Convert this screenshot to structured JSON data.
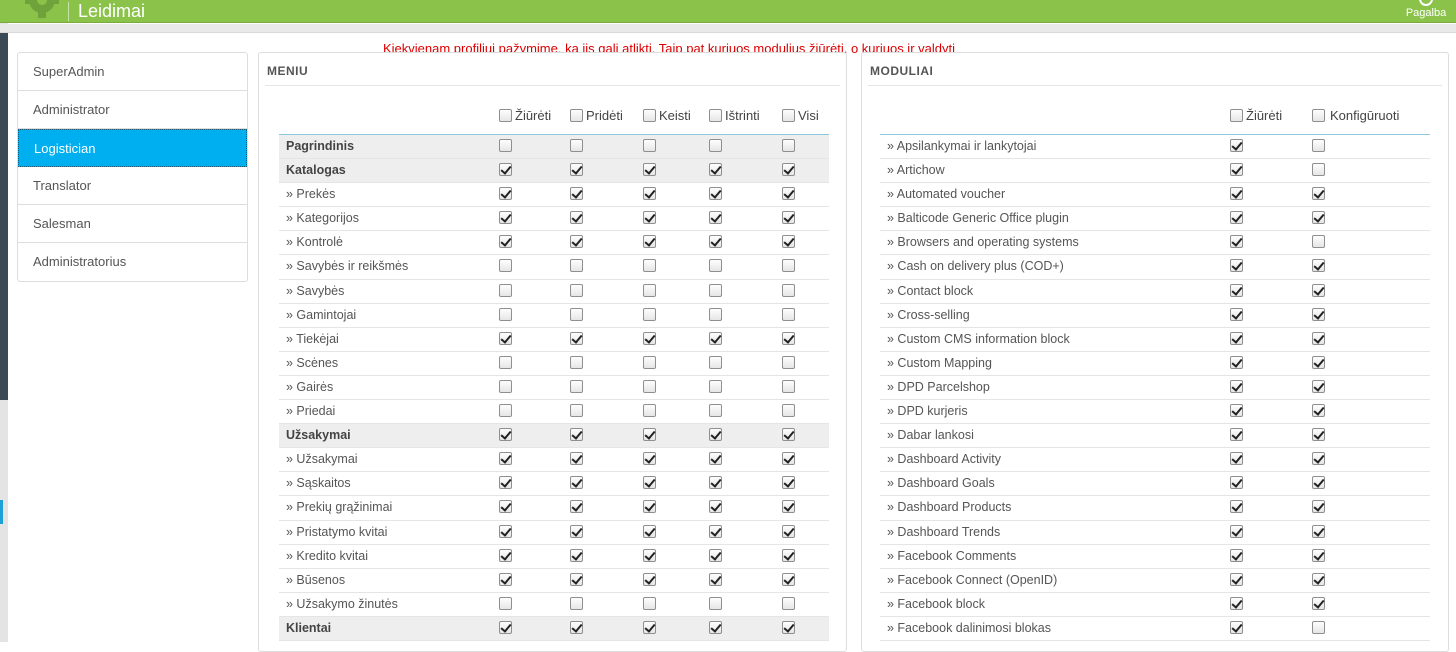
{
  "header": {
    "title": "Leidimai",
    "help_label": "Pagalba",
    "accent": "#8bc34a"
  },
  "notice": "Kiekvienam profiliui pažymime, ką jis gali atlikti. Taip pat kuriuos modulius žiūrėti, o kuriuos ir valdyti",
  "profiles": [
    {
      "label": "SuperAdmin",
      "active": false
    },
    {
      "label": "Administrator",
      "active": false
    },
    {
      "label": "Logistician",
      "active": true
    },
    {
      "label": "Translator",
      "active": false
    },
    {
      "label": "Salesman",
      "active": false
    },
    {
      "label": "Administratorius",
      "active": false
    }
  ],
  "menu": {
    "title": "MENIU",
    "columns": [
      "Žiūrėti",
      "Pridėti",
      "Keisti",
      "Ištrinti",
      "Visi"
    ],
    "rows": [
      {
        "label": "Pagrindinis",
        "group": true,
        "checks": [
          false,
          false,
          false,
          false,
          false
        ]
      },
      {
        "label": "Katalogas",
        "group": true,
        "checks": [
          true,
          true,
          true,
          true,
          true
        ]
      },
      {
        "label": "» Prekės",
        "group": false,
        "checks": [
          true,
          true,
          true,
          true,
          true
        ]
      },
      {
        "label": "» Kategorijos",
        "group": false,
        "checks": [
          true,
          true,
          true,
          true,
          true
        ]
      },
      {
        "label": "» Kontrolė",
        "group": false,
        "checks": [
          true,
          true,
          true,
          true,
          true
        ]
      },
      {
        "label": "» Savybės ir reikšmės",
        "group": false,
        "checks": [
          false,
          false,
          false,
          false,
          false
        ]
      },
      {
        "label": "» Savybės",
        "group": false,
        "checks": [
          false,
          false,
          false,
          false,
          false
        ]
      },
      {
        "label": "» Gamintojai",
        "group": false,
        "checks": [
          false,
          false,
          false,
          false,
          false
        ]
      },
      {
        "label": "» Tiekėjai",
        "group": false,
        "checks": [
          true,
          true,
          true,
          true,
          true
        ]
      },
      {
        "label": "» Scėnes",
        "group": false,
        "checks": [
          false,
          false,
          false,
          false,
          false
        ]
      },
      {
        "label": "» Gairės",
        "group": false,
        "checks": [
          false,
          false,
          false,
          false,
          false
        ]
      },
      {
        "label": "» Priedai",
        "group": false,
        "checks": [
          false,
          false,
          false,
          false,
          false
        ]
      },
      {
        "label": "Užsakymai",
        "group": true,
        "checks": [
          true,
          true,
          true,
          true,
          true
        ]
      },
      {
        "label": "» Užsakymai",
        "group": false,
        "checks": [
          true,
          true,
          true,
          true,
          true
        ]
      },
      {
        "label": "» Sąskaitos",
        "group": false,
        "checks": [
          true,
          true,
          true,
          true,
          true
        ]
      },
      {
        "label": "» Prekių grąžinimai",
        "group": false,
        "checks": [
          true,
          true,
          true,
          true,
          true
        ]
      },
      {
        "label": "» Pristatymo kvitai",
        "group": false,
        "checks": [
          true,
          true,
          true,
          true,
          true
        ]
      },
      {
        "label": "» Kredito kvitai",
        "group": false,
        "checks": [
          true,
          true,
          true,
          true,
          true
        ]
      },
      {
        "label": "» Būsenos",
        "group": false,
        "checks": [
          true,
          true,
          true,
          true,
          true
        ]
      },
      {
        "label": "» Užsakymo žinutės",
        "group": false,
        "checks": [
          false,
          false,
          false,
          false,
          false
        ]
      },
      {
        "label": "Klientai",
        "group": true,
        "checks": [
          true,
          true,
          true,
          true,
          true
        ]
      }
    ]
  },
  "modules": {
    "title": "MODULIAI",
    "columns": [
      "Žiūrėti",
      "Konfigūruoti"
    ],
    "rows": [
      {
        "label": "» Apsilankymai ir lankytojai",
        "checks": [
          true,
          false
        ]
      },
      {
        "label": "» Artichow",
        "checks": [
          true,
          false
        ]
      },
      {
        "label": "» Automated voucher",
        "checks": [
          true,
          true
        ]
      },
      {
        "label": "» Balticode Generic Office plugin",
        "checks": [
          true,
          true
        ]
      },
      {
        "label": "» Browsers and operating systems",
        "checks": [
          true,
          false
        ]
      },
      {
        "label": "» Cash on delivery plus (COD+)",
        "checks": [
          true,
          true
        ]
      },
      {
        "label": "» Contact block",
        "checks": [
          true,
          true
        ]
      },
      {
        "label": "» Cross-selling",
        "checks": [
          true,
          true
        ]
      },
      {
        "label": "» Custom CMS information block",
        "checks": [
          true,
          true
        ]
      },
      {
        "label": "» Custom Mapping",
        "checks": [
          true,
          true
        ]
      },
      {
        "label": "» DPD Parcelshop",
        "checks": [
          true,
          true
        ]
      },
      {
        "label": "» DPD kurjeris",
        "checks": [
          true,
          true
        ]
      },
      {
        "label": "» Dabar lankosi",
        "checks": [
          true,
          true
        ]
      },
      {
        "label": "» Dashboard Activity",
        "checks": [
          true,
          true
        ]
      },
      {
        "label": "» Dashboard Goals",
        "checks": [
          true,
          true
        ]
      },
      {
        "label": "» Dashboard Products",
        "checks": [
          true,
          true
        ]
      },
      {
        "label": "» Dashboard Trends",
        "checks": [
          true,
          true
        ]
      },
      {
        "label": "» Facebook Comments",
        "checks": [
          true,
          true
        ]
      },
      {
        "label": "» Facebook Connect (OpenID)",
        "checks": [
          true,
          true
        ]
      },
      {
        "label": "» Facebook block",
        "checks": [
          true,
          true
        ]
      },
      {
        "label": "» Facebook dalinimosi blokas",
        "checks": [
          true,
          false
        ]
      }
    ]
  }
}
